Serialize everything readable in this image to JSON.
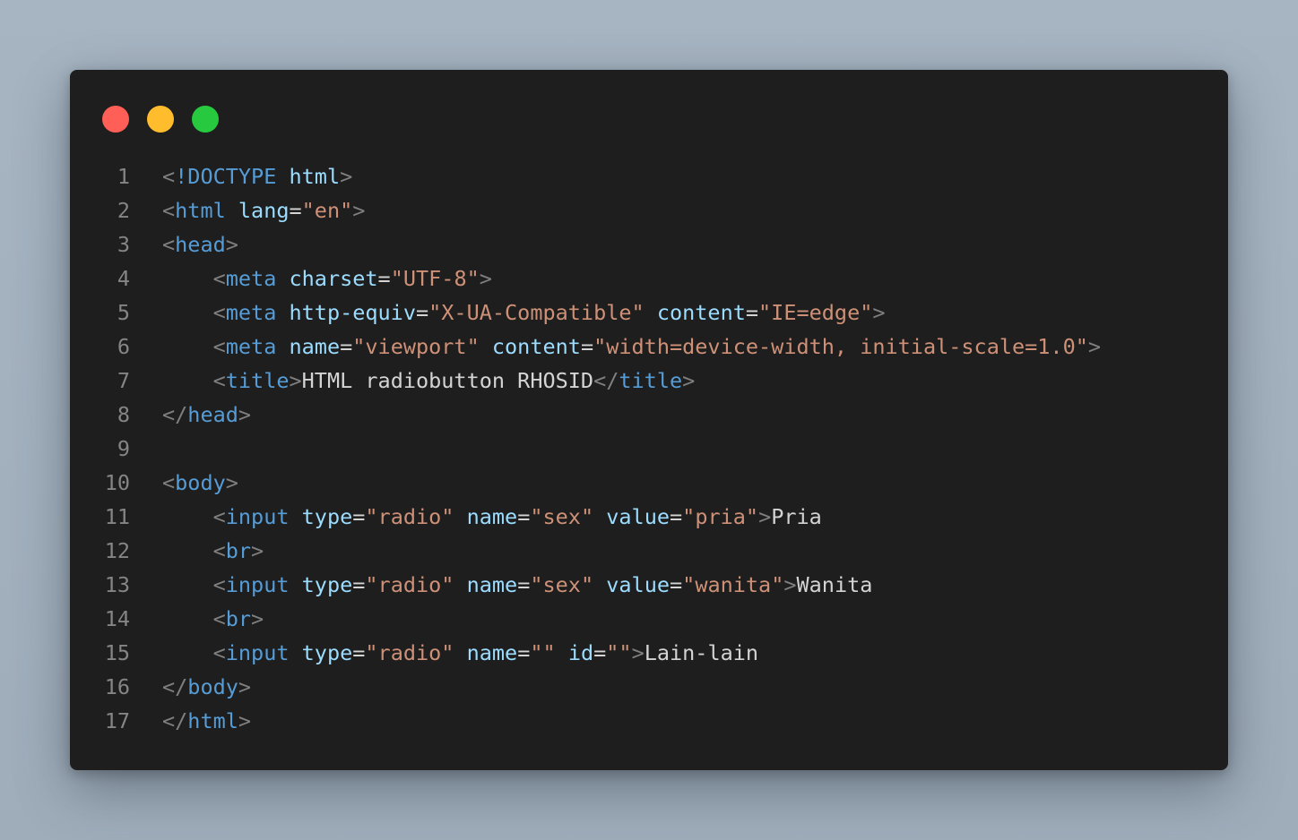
{
  "window": {
    "controls": [
      {
        "name": "close-dot",
        "color": "#ff5f56"
      },
      {
        "name": "minimize-dot",
        "color": "#ffbd2e"
      },
      {
        "name": "maximize-dot",
        "color": "#27c93f"
      }
    ]
  },
  "editor": {
    "lines": [
      {
        "num": "1",
        "tokens": [
          {
            "t": "punct",
            "v": "<"
          },
          {
            "t": "tag",
            "v": "!DOCTYPE"
          },
          {
            "t": "text",
            "v": " "
          },
          {
            "t": "attr",
            "v": "html"
          },
          {
            "t": "punct",
            "v": ">"
          }
        ]
      },
      {
        "num": "2",
        "tokens": [
          {
            "t": "punct",
            "v": "<"
          },
          {
            "t": "tag",
            "v": "html"
          },
          {
            "t": "text",
            "v": " "
          },
          {
            "t": "attr",
            "v": "lang"
          },
          {
            "t": "text",
            "v": "="
          },
          {
            "t": "str",
            "v": "\"en\""
          },
          {
            "t": "punct",
            "v": ">"
          }
        ]
      },
      {
        "num": "3",
        "tokens": [
          {
            "t": "punct",
            "v": "<"
          },
          {
            "t": "tag",
            "v": "head"
          },
          {
            "t": "punct",
            "v": ">"
          }
        ]
      },
      {
        "num": "4",
        "tokens": [
          {
            "t": "text",
            "v": "    "
          },
          {
            "t": "punct",
            "v": "<"
          },
          {
            "t": "tag",
            "v": "meta"
          },
          {
            "t": "text",
            "v": " "
          },
          {
            "t": "attr",
            "v": "charset"
          },
          {
            "t": "text",
            "v": "="
          },
          {
            "t": "str",
            "v": "\"UTF-8\""
          },
          {
            "t": "punct",
            "v": ">"
          }
        ]
      },
      {
        "num": "5",
        "tokens": [
          {
            "t": "text",
            "v": "    "
          },
          {
            "t": "punct",
            "v": "<"
          },
          {
            "t": "tag",
            "v": "meta"
          },
          {
            "t": "text",
            "v": " "
          },
          {
            "t": "attr",
            "v": "http-equiv"
          },
          {
            "t": "text",
            "v": "="
          },
          {
            "t": "str",
            "v": "\"X-UA-Compatible\""
          },
          {
            "t": "text",
            "v": " "
          },
          {
            "t": "attr",
            "v": "content"
          },
          {
            "t": "text",
            "v": "="
          },
          {
            "t": "str",
            "v": "\"IE=edge\""
          },
          {
            "t": "punct",
            "v": ">"
          }
        ]
      },
      {
        "num": "6",
        "tokens": [
          {
            "t": "text",
            "v": "    "
          },
          {
            "t": "punct",
            "v": "<"
          },
          {
            "t": "tag",
            "v": "meta"
          },
          {
            "t": "text",
            "v": " "
          },
          {
            "t": "attr",
            "v": "name"
          },
          {
            "t": "text",
            "v": "="
          },
          {
            "t": "str",
            "v": "\"viewport\""
          },
          {
            "t": "text",
            "v": " "
          },
          {
            "t": "attr",
            "v": "content"
          },
          {
            "t": "text",
            "v": "="
          },
          {
            "t": "str",
            "v": "\"width=device-width, initial-scale=1.0\""
          },
          {
            "t": "punct",
            "v": ">"
          }
        ]
      },
      {
        "num": "7",
        "tokens": [
          {
            "t": "text",
            "v": "    "
          },
          {
            "t": "punct",
            "v": "<"
          },
          {
            "t": "tag",
            "v": "title"
          },
          {
            "t": "punct",
            "v": ">"
          },
          {
            "t": "text",
            "v": "HTML radiobutton RHOSID"
          },
          {
            "t": "punct",
            "v": "</"
          },
          {
            "t": "tag",
            "v": "title"
          },
          {
            "t": "punct",
            "v": ">"
          }
        ]
      },
      {
        "num": "8",
        "tokens": [
          {
            "t": "punct",
            "v": "</"
          },
          {
            "t": "tag",
            "v": "head"
          },
          {
            "t": "punct",
            "v": ">"
          }
        ]
      },
      {
        "num": "9",
        "tokens": []
      },
      {
        "num": "10",
        "tokens": [
          {
            "t": "punct",
            "v": "<"
          },
          {
            "t": "tag",
            "v": "body"
          },
          {
            "t": "punct",
            "v": ">"
          }
        ]
      },
      {
        "num": "11",
        "tokens": [
          {
            "t": "text",
            "v": "    "
          },
          {
            "t": "punct",
            "v": "<"
          },
          {
            "t": "tag",
            "v": "input"
          },
          {
            "t": "text",
            "v": " "
          },
          {
            "t": "attr",
            "v": "type"
          },
          {
            "t": "text",
            "v": "="
          },
          {
            "t": "str",
            "v": "\"radio\""
          },
          {
            "t": "text",
            "v": " "
          },
          {
            "t": "attr",
            "v": "name"
          },
          {
            "t": "text",
            "v": "="
          },
          {
            "t": "str",
            "v": "\"sex\""
          },
          {
            "t": "text",
            "v": " "
          },
          {
            "t": "attr",
            "v": "value"
          },
          {
            "t": "text",
            "v": "="
          },
          {
            "t": "str",
            "v": "\"pria\""
          },
          {
            "t": "punct",
            "v": ">"
          },
          {
            "t": "text",
            "v": "Pria"
          }
        ]
      },
      {
        "num": "12",
        "tokens": [
          {
            "t": "text",
            "v": "    "
          },
          {
            "t": "punct",
            "v": "<"
          },
          {
            "t": "tag",
            "v": "br"
          },
          {
            "t": "punct",
            "v": ">"
          }
        ]
      },
      {
        "num": "13",
        "tokens": [
          {
            "t": "text",
            "v": "    "
          },
          {
            "t": "punct",
            "v": "<"
          },
          {
            "t": "tag",
            "v": "input"
          },
          {
            "t": "text",
            "v": " "
          },
          {
            "t": "attr",
            "v": "type"
          },
          {
            "t": "text",
            "v": "="
          },
          {
            "t": "str",
            "v": "\"radio\""
          },
          {
            "t": "text",
            "v": " "
          },
          {
            "t": "attr",
            "v": "name"
          },
          {
            "t": "text",
            "v": "="
          },
          {
            "t": "str",
            "v": "\"sex\""
          },
          {
            "t": "text",
            "v": " "
          },
          {
            "t": "attr",
            "v": "value"
          },
          {
            "t": "text",
            "v": "="
          },
          {
            "t": "str",
            "v": "\"wanita\""
          },
          {
            "t": "punct",
            "v": ">"
          },
          {
            "t": "text",
            "v": "Wanita"
          }
        ]
      },
      {
        "num": "14",
        "tokens": [
          {
            "t": "text",
            "v": "    "
          },
          {
            "t": "punct",
            "v": "<"
          },
          {
            "t": "tag",
            "v": "br"
          },
          {
            "t": "punct",
            "v": ">"
          }
        ]
      },
      {
        "num": "15",
        "tokens": [
          {
            "t": "text",
            "v": "    "
          },
          {
            "t": "punct",
            "v": "<"
          },
          {
            "t": "tag",
            "v": "input"
          },
          {
            "t": "text",
            "v": " "
          },
          {
            "t": "attr",
            "v": "type"
          },
          {
            "t": "text",
            "v": "="
          },
          {
            "t": "str",
            "v": "\"radio\""
          },
          {
            "t": "text",
            "v": " "
          },
          {
            "t": "attr",
            "v": "name"
          },
          {
            "t": "text",
            "v": "="
          },
          {
            "t": "str",
            "v": "\"\""
          },
          {
            "t": "text",
            "v": " "
          },
          {
            "t": "attr",
            "v": "id"
          },
          {
            "t": "text",
            "v": "="
          },
          {
            "t": "str",
            "v": "\"\""
          },
          {
            "t": "punct",
            "v": ">"
          },
          {
            "t": "text",
            "v": "Lain-lain"
          }
        ]
      },
      {
        "num": "16",
        "tokens": [
          {
            "t": "punct",
            "v": "</"
          },
          {
            "t": "tag",
            "v": "body"
          },
          {
            "t": "punct",
            "v": ">"
          }
        ]
      },
      {
        "num": "17",
        "tokens": [
          {
            "t": "punct",
            "v": "</"
          },
          {
            "t": "tag",
            "v": "html"
          },
          {
            "t": "punct",
            "v": ">"
          }
        ]
      }
    ]
  }
}
